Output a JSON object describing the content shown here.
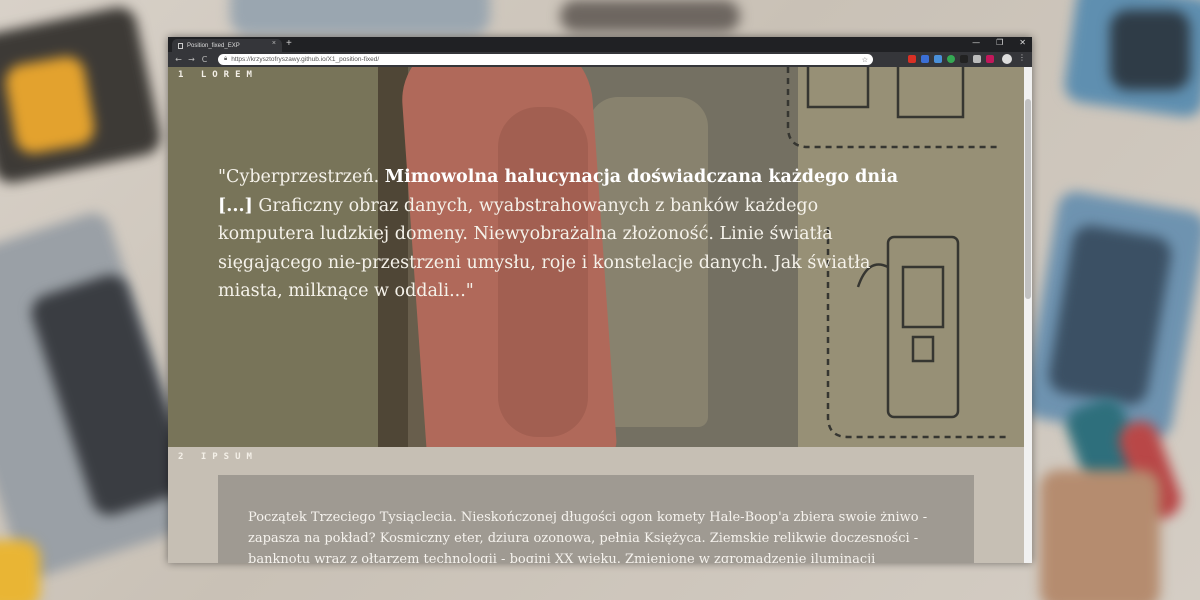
{
  "browser": {
    "tab_title": "Position_fixed_EXP",
    "tab_close": "×",
    "new_tab": "+",
    "url": "https://krzysztofryszawy.github.io/X1_position-fixed/",
    "window_controls": [
      "—",
      "❐",
      "✕"
    ],
    "nav": {
      "back": "←",
      "forward": "→",
      "reload": "C"
    },
    "bookmark_icon": "star-icon",
    "extension_colors": [
      "#d93025",
      "#3b6fd6",
      "#4a90d9",
      "#34a853",
      "#222222",
      "#bbbbbb",
      "#c2185b"
    ]
  },
  "sections": [
    {
      "label": "1 LOREM",
      "quote_intro": "\"Cyberprzestrzeń. ",
      "quote_bold": "Mimowolna halucynacja doświadczana każdego dnia [...]",
      "quote_rest": " Graficzny obraz danych, wyabstrahowanych z banków każdego komputera ludzkiej domeny. Niewyobrażalna złożoność. Linie światła sięgającego nie-przestrzeni umysłu, roje i konstelacje danych. Jak światła miasta, milknące w oddali...\""
    },
    {
      "label": "2 IPSUM",
      "text": "Początek Trzeciego Tysiąclecia. Nieskończonej długości ogon komety Hale-Boop'a zbiera swoie żniwo - zapasza na pokład? Kosmiczny eter, dziura ozonowa, pełnia Księżyca. Ziemskie relikwie doczesności - banknotu wraz z ołtarzem technologii - bogini XX wieku. Zmienione w zgromadzenie iluminacji"
    }
  ]
}
